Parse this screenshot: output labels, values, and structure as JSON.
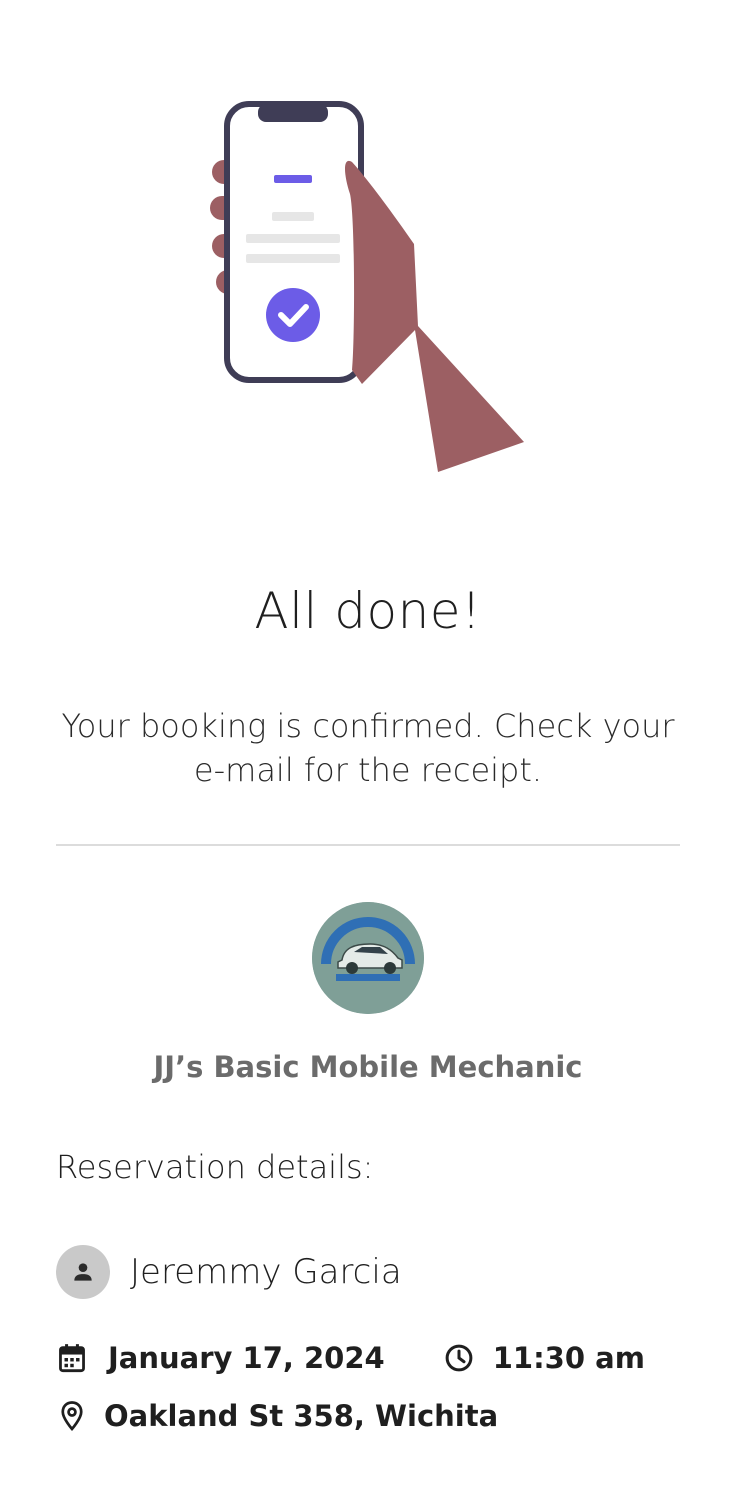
{
  "confirmation": {
    "title": "All done!",
    "message": "Your booking is confirmed. Check your e-mail for the receipt."
  },
  "business": {
    "name": "JJ’s Basic Mobile Mechanic",
    "logo_text": "JJ's BASIC MOBILE MECHANIC"
  },
  "reservation": {
    "section_title": "Reservation details:",
    "customer_name": "Jeremmy Garcia",
    "date": "January 17, 2024",
    "time": "11:30 am",
    "location": "Oakland St 358, Wichita"
  },
  "icons": {
    "illustration": "hand-holding-phone-checkmark",
    "avatar": "person-icon",
    "date": "calendar-icon",
    "time": "clock-icon",
    "location": "location-pin-icon"
  },
  "colors": {
    "accent": "#6c5ce7",
    "skin": "#9c5f63",
    "phone_frame": "#3f3d56",
    "logo_bg": "#7f9f97",
    "business_name": "#6b6b6b",
    "divider": "#dcdcdc"
  }
}
